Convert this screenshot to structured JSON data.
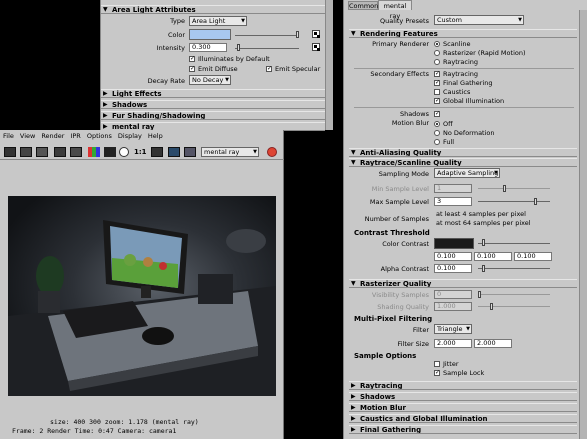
{
  "ae_left": {
    "section_title": "Area Light Attributes",
    "type_label": "Type",
    "type_value": "Area Light",
    "color_label": "Color",
    "intensity_label": "Intensity",
    "intensity_value": "0.300",
    "illuminates_label": "Illuminates by Default",
    "emit_diffuse_label": "Emit Diffuse",
    "emit_specular_label": "Emit Specular",
    "decay_label": "Decay Rate",
    "decay_value": "No Decay",
    "sections": [
      "Light Effects",
      "Shadows",
      "Fur Shading/Shadowing",
      "mental ray"
    ]
  },
  "render_view": {
    "menu": [
      "File",
      "View",
      "Render",
      "IPR",
      "Options",
      "Display",
      "Help"
    ],
    "ratio": "1:1",
    "renderer_dropdown": "mental ray",
    "status_line1": "size:  400  300 zoom: 1.178    (mental ray)",
    "status_line2": "Frame: 2       Render Time: 0:47      Camera: camera1"
  },
  "rs": {
    "tab_common": "Common",
    "tab_mental_ray": "mental ray",
    "quality_presets_label": "Quality Presets",
    "quality_presets_value": "Custom",
    "rendering_features": "Rendering Features",
    "primary_renderer_label": "Primary Renderer",
    "primary_options": [
      "Scanline",
      "Rasterizer (Rapid Motion)",
      "Raytracing"
    ],
    "secondary_effects_label": "Secondary Effects",
    "secondary_options": [
      "Raytracing",
      "Final Gathering",
      "Caustics",
      "Global Illumination"
    ],
    "shadows_label": "Shadows",
    "motion_blur_label": "Motion Blur",
    "motion_options": [
      "Off",
      "No Deformation",
      "Full"
    ],
    "anti_aliasing": "Anti-Aliasing Quality",
    "raytrace_scanline": "Raytrace/Scanline Quality",
    "sampling_mode_label": "Sampling Mode",
    "sampling_mode_value": "Adaptive Sampling",
    "min_sample_label": "Min Sample Level",
    "min_sample_value": "1",
    "max_sample_label": "Max Sample Level",
    "max_sample_value": "3",
    "num_samples_label": "Number of Samples",
    "num_samples_line1": "at least 4 samples per pixel",
    "num_samples_line2": "at most 64 samples per pixel",
    "contrast_threshold": "Contrast Threshold",
    "color_contrast_label": "Color Contrast",
    "contrast_values": [
      "0.100",
      "0.100",
      "0.100"
    ],
    "alpha_contrast_label": "Alpha Contrast",
    "alpha_contrast_value": "0.100",
    "rasterizer_quality": "Rasterizer Quality",
    "visibility_samples_label": "Visibility Samples",
    "visibility_samples_value": "0",
    "shading_quality_label": "Shading Quality",
    "shading_quality_value": "1.000",
    "multi_pixel": "Multi-Pixel Filtering",
    "filter_label": "Filter",
    "filter_value": "Triangle",
    "filter_size_label": "Filter Size",
    "filter_size_values": [
      "2.000",
      "2.000"
    ],
    "sample_options": "Sample Options",
    "jitter_label": "Jitter",
    "sample_lock_label": "Sample Lock",
    "bottom_sections": [
      "Raytracing",
      "Shadows",
      "Motion Blur",
      "Caustics and Global Illumination",
      "Final Gathering"
    ]
  },
  "colors": {
    "panel_bg": "#c8c8c8",
    "light_color": "#a8c8f0",
    "contrast_swatch": "#1a1a1a",
    "screen_accent": "#5aa03a"
  }
}
